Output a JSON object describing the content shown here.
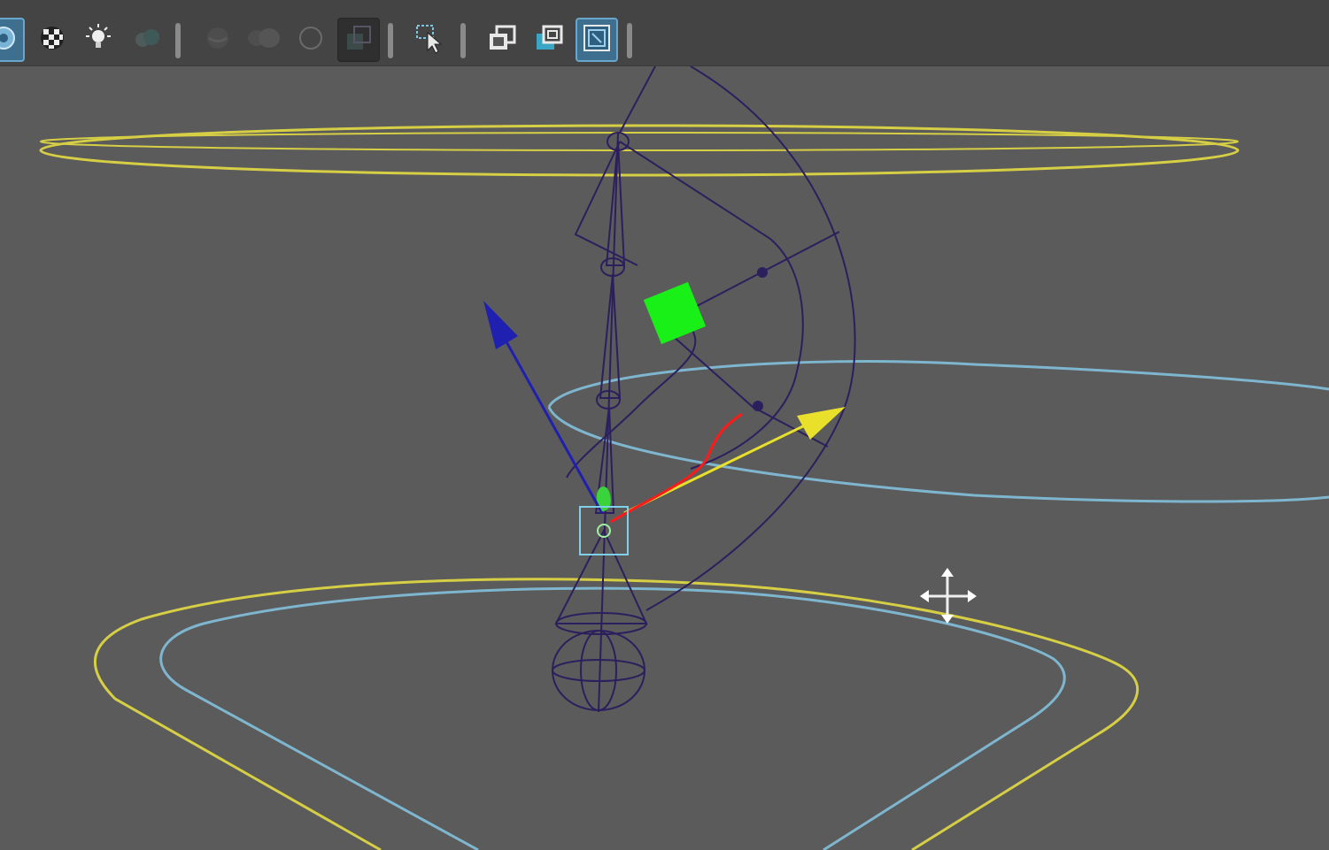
{
  "toolbar": {
    "buttons": [
      {
        "id": "isolate",
        "icon": "isolate-select-icon",
        "state": "active"
      },
      {
        "id": "textured",
        "icon": "checker-texture-icon",
        "state": "normal"
      },
      {
        "id": "lighting",
        "icon": "light-bulb-icon",
        "state": "normal"
      },
      {
        "id": "shadows",
        "icon": "shadow-sphere-icon",
        "state": "dimmed"
      },
      {
        "id": "ambient-occlusion",
        "icon": "ambient-occlusion-icon",
        "state": "dimmed"
      },
      {
        "id": "motion-blur",
        "icon": "motion-blur-icon",
        "state": "dimmed"
      },
      {
        "id": "antialiasing",
        "icon": "antialias-ring-icon",
        "state": "dimmed"
      },
      {
        "id": "depth-of-field",
        "icon": "depth-of-field-icon",
        "state": "pressed"
      },
      {
        "id": "select-camera",
        "icon": "select-cursor-icon",
        "state": "normal"
      },
      {
        "id": "gate-mask",
        "icon": "film-gate-icon",
        "state": "normal"
      },
      {
        "id": "resolution-gate",
        "icon": "resolution-gate-icon",
        "state": "normal"
      },
      {
        "id": "frame-gate",
        "icon": "frame-gate-icon",
        "state": "active"
      }
    ]
  },
  "viewport": {
    "colors": {
      "background": "#5b5b5b",
      "yellow_curve": "#d6cf45",
      "cyan_curve": "#7fb6cf",
      "wireframe": "#2c1f5e",
      "green_handle": "#18f018",
      "blue_arrow": "#2020b0",
      "yellow_arrow": "#e8e02a",
      "red_stroke": "#ff1a1a"
    },
    "cursor": "move-cursor-icon"
  }
}
